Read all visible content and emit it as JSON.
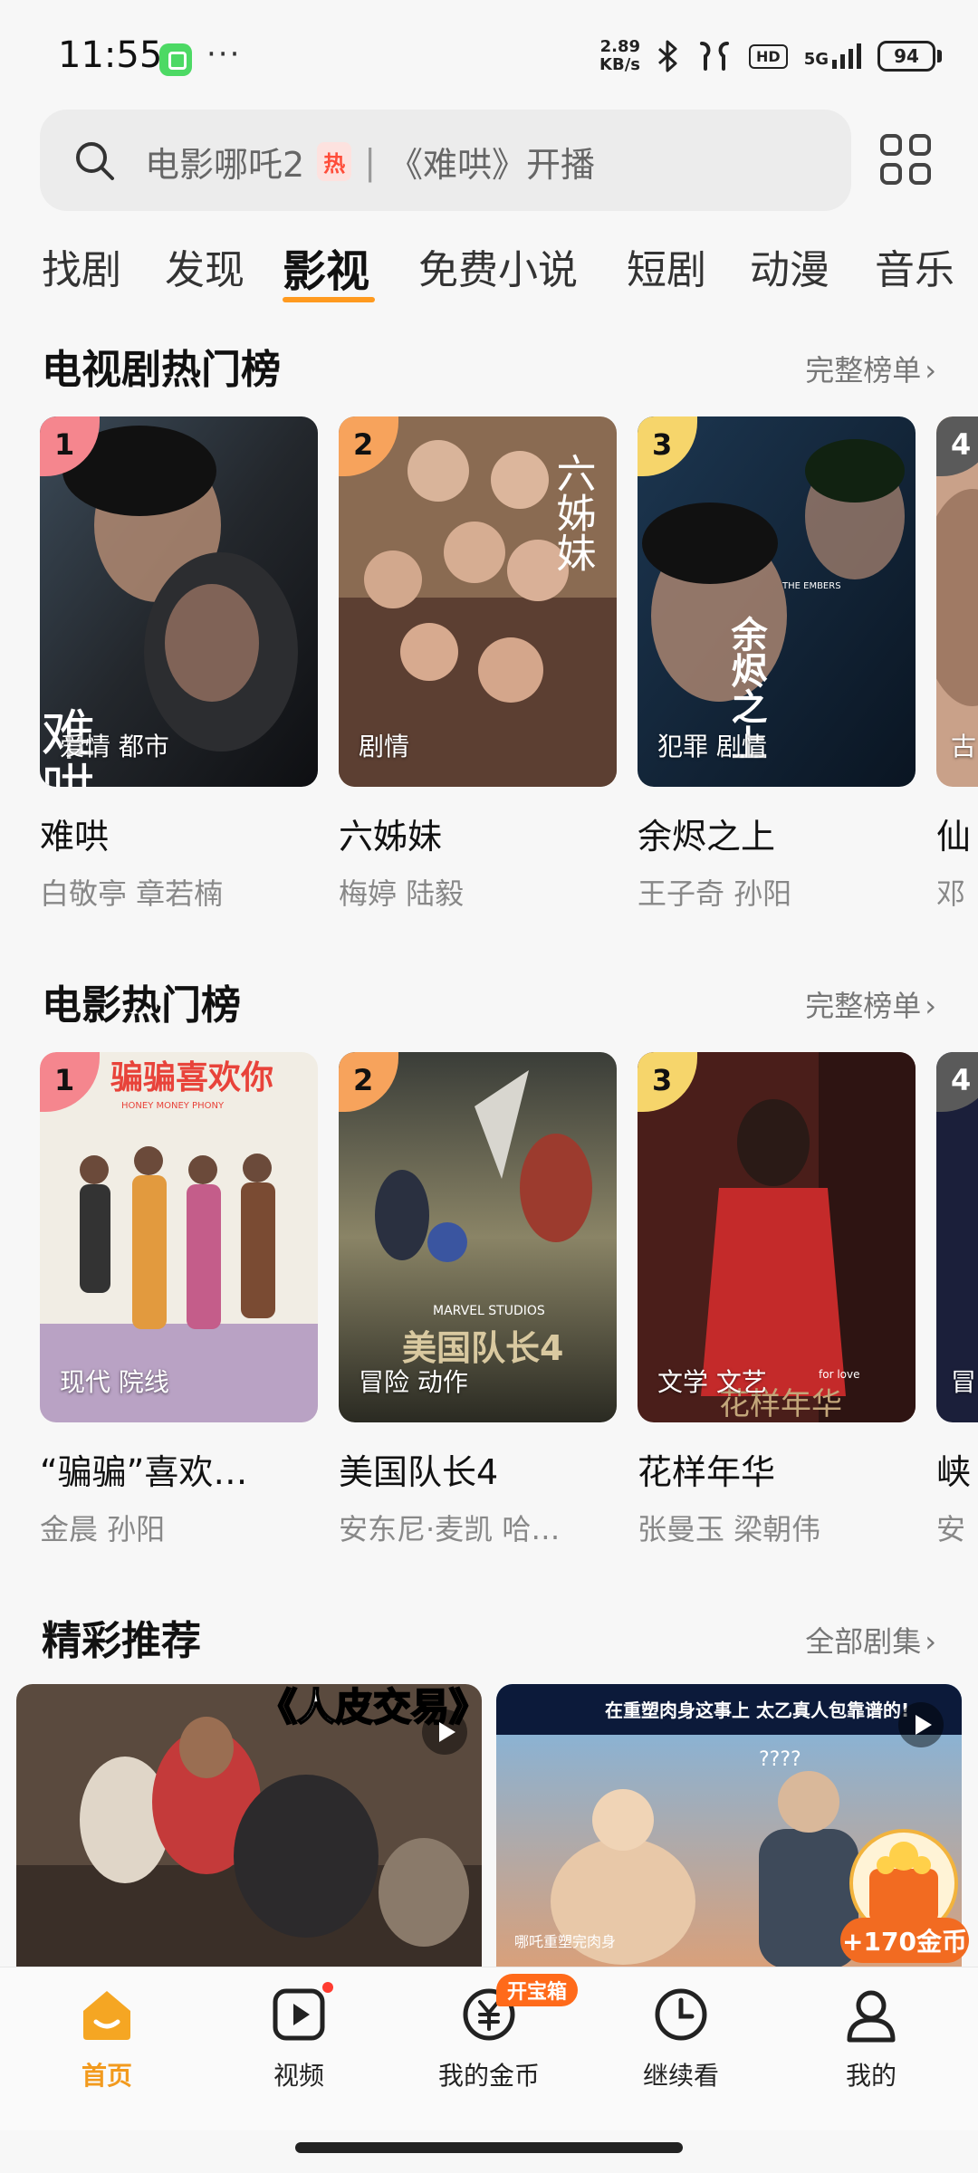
{
  "status_bar": {
    "time": "11:55",
    "more": "···",
    "net_speed_value": "2.89",
    "net_speed_unit": "KB/s",
    "hd": "HD",
    "network": "5G",
    "battery": "94",
    "icons": [
      "app-notification-icon",
      "bluetooth-icon",
      "earbuds-icon",
      "hd-icon",
      "signal-icon",
      "battery-icon"
    ]
  },
  "search": {
    "query_1": "电影哪吒2",
    "hot_badge": "热",
    "separator": "|",
    "query_2": "《难哄》开播"
  },
  "tabs": [
    {
      "label": "找剧"
    },
    {
      "label": "发现"
    },
    {
      "label": "影视",
      "active": true
    },
    {
      "label": "免费小说"
    },
    {
      "label": "短剧"
    },
    {
      "label": "动漫"
    },
    {
      "label": "音乐"
    }
  ],
  "tv_section": {
    "title": "电视剧热门榜",
    "more": "完整榜单",
    "cards": [
      {
        "rank": "1",
        "tag": "爱情 都市",
        "title": "难哄",
        "cast": "白敬亭 章若楠",
        "poster_text": "难哄"
      },
      {
        "rank": "2",
        "tag": "剧情",
        "title": "六姊妹",
        "cast": "梅婷 陆毅",
        "poster_text": "六姊妹"
      },
      {
        "rank": "3",
        "tag": "犯罪 剧情",
        "title": "余烬之上",
        "cast": "王子奇 孙阳",
        "poster_text": "余烬之上",
        "poster_text_en": "THE EMBERS"
      },
      {
        "rank": "4",
        "tag": "古",
        "title": "仙",
        "cast": "邓"
      }
    ]
  },
  "movie_section": {
    "title": "电影热门榜",
    "more": "完整榜单",
    "cards": [
      {
        "rank": "1",
        "tag": "现代 院线",
        "title": "“骗骗”喜欢…",
        "cast": "金晨 孙阳",
        "poster_text": "骗骗喜欢你",
        "poster_text_en": "HONEY MONEY PHONY"
      },
      {
        "rank": "2",
        "tag": "冒险 动作",
        "title": "美国队长4",
        "cast": "安东尼·麦凯 哈…",
        "poster_text": "美国队长4",
        "poster_text_en": "MARVEL STUDIOS"
      },
      {
        "rank": "3",
        "tag": "文学 文艺",
        "title": "花样年华",
        "cast": "张曼玉 梁朝伟",
        "poster_text": "花样年华",
        "poster_text_en": "for love"
      },
      {
        "rank": "4",
        "tag": "冒",
        "title": "峡",
        "cast": "安"
      }
    ]
  },
  "rec_section": {
    "title": "精彩推荐",
    "more": "全部剧集",
    "videos": [
      {
        "overlay_title": "《人皮交易》"
      },
      {
        "overlay_title": "在重塑肉身这事上 太乙真人包靠谱的!",
        "overlay_caption": "哪吒重塑完肉身",
        "overlay_q": "????"
      }
    ],
    "coin_reward": "+170金币"
  },
  "bottom_nav": [
    {
      "label": "首页",
      "icon": "home-icon",
      "active": true
    },
    {
      "label": "视频",
      "icon": "video-icon"
    },
    {
      "label": "我的金币",
      "icon": "coin-icon"
    },
    {
      "label": "继续看",
      "icon": "history-icon"
    },
    {
      "label": "我的",
      "icon": "profile-icon"
    }
  ],
  "chest_badge": "开宝箱",
  "colors": {
    "accent": "#ff9a1f",
    "hot": "#ff4d3a",
    "rank1": "#f5868e",
    "rank2": "#f7a35c",
    "rank3": "#f6d56b",
    "coin": "#f26b21"
  }
}
